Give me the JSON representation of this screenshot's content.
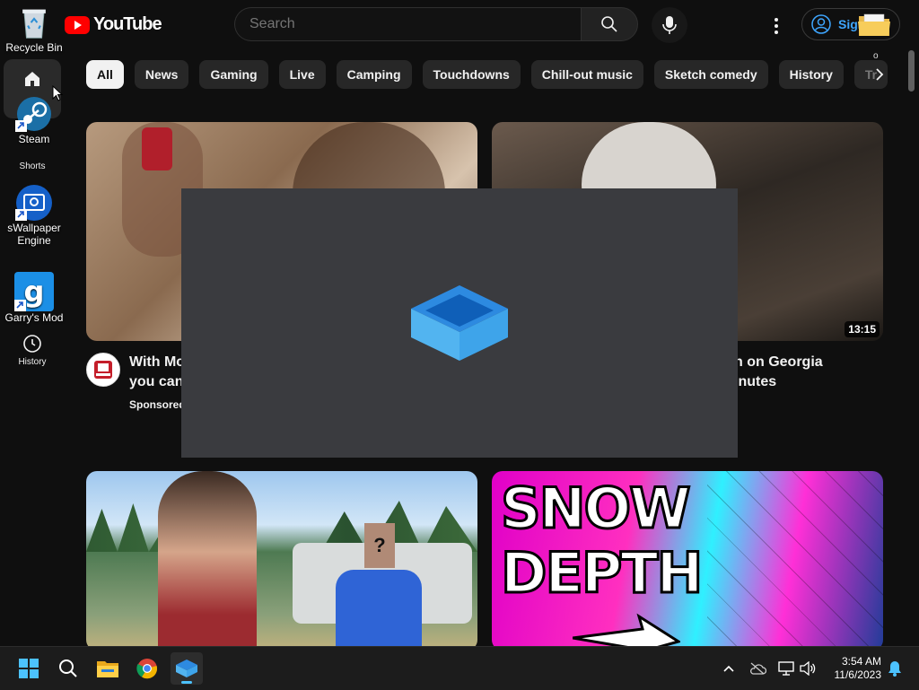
{
  "youtube": {
    "logo_text": "YouTube",
    "search_placeholder": "Search",
    "signin_label": "Sign in",
    "chips": [
      "All",
      "News",
      "Gaming",
      "Live",
      "Camping",
      "Touchdowns",
      "Chill-out music",
      "Sketch comedy",
      "History",
      "Tr"
    ],
    "chip_dot": "o",
    "sidebar": {
      "home_label": "Home",
      "shorts_label": "Shorts",
      "history_label": "History"
    },
    "videos": [
      {
        "title_line1": "With Mc",
        "title_line2": "you can",
        "meta": "Sponsored"
      },
      {
        "title_line1": "n on Georgia",
        "title_line2": "inutes",
        "duration": "13:15"
      },
      {
        "thumb_badge": "?"
      },
      {
        "thumb_line1": "SNOW",
        "thumb_line2": "DEPTH"
      }
    ],
    "colors": {
      "background": "#0f0f0f",
      "brand_red": "#ff0000",
      "signin_blue": "#3ea6ff",
      "chip_bg": "#272727"
    }
  },
  "desktop": {
    "icons": [
      {
        "label": "Recycle Bin",
        "icon": "recycle-bin-icon"
      },
      {
        "label": "Steam",
        "icon": "steam-icon"
      },
      {
        "label_line1": "Wallpaper",
        "label_line2": "Engine",
        "prefix": "s",
        "icon": "wallpaper-engine-icon"
      },
      {
        "label": "Garry's Mod",
        "icon": "garrys-mod-icon"
      }
    ]
  },
  "splash": {
    "icon": "dropbox-box-icon",
    "bg": "#3a3b3f"
  },
  "taskbar": {
    "apps": [
      "start-icon",
      "search-icon",
      "file-explorer-icon",
      "chrome-icon",
      "dropbox-icon"
    ],
    "time": "3:54 AM",
    "date": "11/6/2023"
  }
}
